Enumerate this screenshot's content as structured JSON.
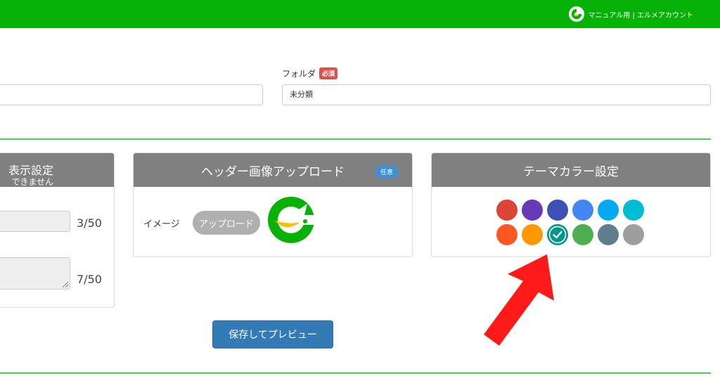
{
  "header": {
    "account_name": "マニュアル用 | エルメアカウント",
    "bg_color": "#06b206"
  },
  "folder": {
    "label": "フォルダ",
    "required_badge": "必須",
    "value": "未分類"
  },
  "display_panel": {
    "title": "表示設定",
    "subtitle": "できません",
    "counter1": "3/50",
    "counter2": "7/50"
  },
  "upload_panel": {
    "title": "ヘッダー画像アップロード",
    "optional_badge": "任意",
    "image_label": "イメージ",
    "upload_button": "アップロード"
  },
  "theme_panel": {
    "title": "テーマカラー設定",
    "colors": [
      {
        "hex": "#db4437",
        "selected": false
      },
      {
        "hex": "#673ab7",
        "selected": false
      },
      {
        "hex": "#3f51b5",
        "selected": false
      },
      {
        "hex": "#4285f4",
        "selected": false
      },
      {
        "hex": "#03a9f4",
        "selected": false
      },
      {
        "hex": "#00bcd4",
        "selected": false
      },
      {
        "hex": "#ff5722",
        "selected": false
      },
      {
        "hex": "#ff9800",
        "selected": false
      },
      {
        "hex": "#009688",
        "selected": true
      },
      {
        "hex": "#4caf50",
        "selected": false
      },
      {
        "hex": "#607d8b",
        "selected": false
      },
      {
        "hex": "#9e9e9e",
        "selected": false
      }
    ]
  },
  "actions": {
    "save_preview": "保存してプレビュー"
  },
  "annotation": {
    "arrow_color": "#ff1a1a",
    "arrow_icon": "red-pointer-arrow"
  }
}
